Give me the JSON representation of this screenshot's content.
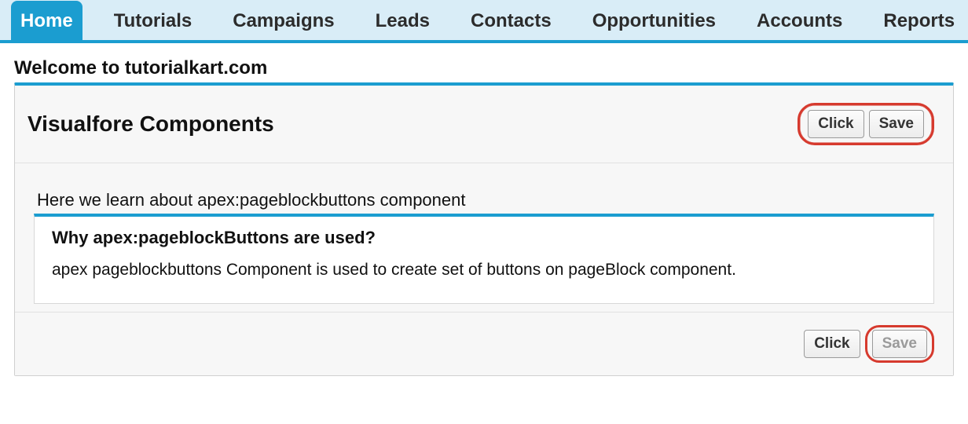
{
  "nav": {
    "tabs": [
      {
        "label": "Home",
        "active": true
      },
      {
        "label": "Tutorials",
        "active": false
      },
      {
        "label": "Campaigns",
        "active": false
      },
      {
        "label": "Leads",
        "active": false
      },
      {
        "label": "Contacts",
        "active": false
      },
      {
        "label": "Opportunities",
        "active": false
      },
      {
        "label": "Accounts",
        "active": false
      },
      {
        "label": "Reports",
        "active": false
      }
    ]
  },
  "page": {
    "welcome": "Welcome to tutorialkart.com"
  },
  "pageBlock": {
    "title": "Visualfore Components",
    "topButtons": {
      "click": "Click",
      "save": "Save"
    },
    "intro": "Here we learn about apex:pageblockbuttons component",
    "subTitle": "Why apex:pageblockButtons are used?",
    "subBody": "apex pageblockbuttons Component is used to create  set of buttons on pageBlock component.",
    "bottomButtons": {
      "click": "Click",
      "save": "Save"
    }
  },
  "colors": {
    "accent": "#1b9dd0",
    "tabbar_bg": "#d9edf7",
    "annotation": "#d63a2e"
  }
}
